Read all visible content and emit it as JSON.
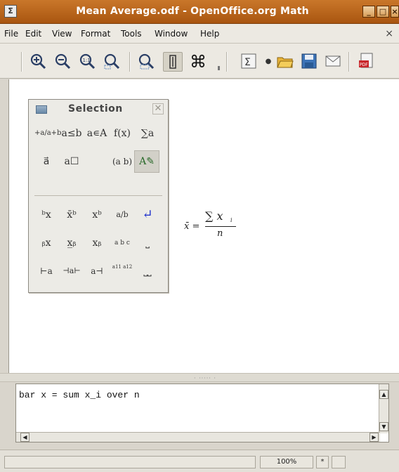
{
  "window": {
    "title": "Mean Average.odf - OpenOffice.org Math",
    "app_icon_glyph": "Σ"
  },
  "menu": {
    "items": [
      "File",
      "Edit",
      "View",
      "Format",
      "Tools",
      "Window",
      "Help"
    ],
    "underlines": [
      "F",
      "E",
      "V",
      "o",
      "T",
      "W",
      "H"
    ],
    "close_glyph": "×"
  },
  "toolbar": {
    "icons": [
      "zoom-in-icon",
      "zoom-out-icon",
      "zoom-100-icon",
      "zoom-page-icon",
      "zoom-selection-icon",
      "cursor-icon",
      "symbols-icon",
      "sum-icon",
      "open-folder-icon",
      "save-icon",
      "email-icon",
      "export-pdf-icon"
    ]
  },
  "selection_panel": {
    "title": "Selection",
    "close_glyph": "✕",
    "rows_top": [
      [
        "+a/a+b",
        "a≤b",
        "a∊A",
        "f(x)",
        "∑a"
      ],
      [
        "a⃗",
        "a☐",
        "",
        "(a b)",
        "A✎"
      ]
    ],
    "rows_bottom": [
      [
        "ᵇx",
        "x̄ᵇ",
        "xᵇ",
        "a/b",
        "↵"
      ],
      [
        "ᵦx",
        "x̲ᵦ",
        "xᵦ",
        "a b c",
        "⎵"
      ],
      [
        "⊢a",
        "⊣a⊢",
        "a⊣",
        "a11 a12",
        "⎵⎵"
      ]
    ]
  },
  "formula": {
    "lhs": "x̄ =",
    "numerator": "∑ x",
    "numerator_sub": "i",
    "denominator": "n"
  },
  "splitter": {
    "grip": "· ····· ·"
  },
  "editor": {
    "text": "bar x = sum x_i over n",
    "scroll_up": "▲",
    "scroll_down": "▼",
    "scroll_left": "◀",
    "scroll_right": "▶"
  },
  "status": {
    "zoom": "100%",
    "modified": "*"
  },
  "colors": {
    "titlebar": "#b8611a",
    "enter_arrow": "#2233cc"
  }
}
